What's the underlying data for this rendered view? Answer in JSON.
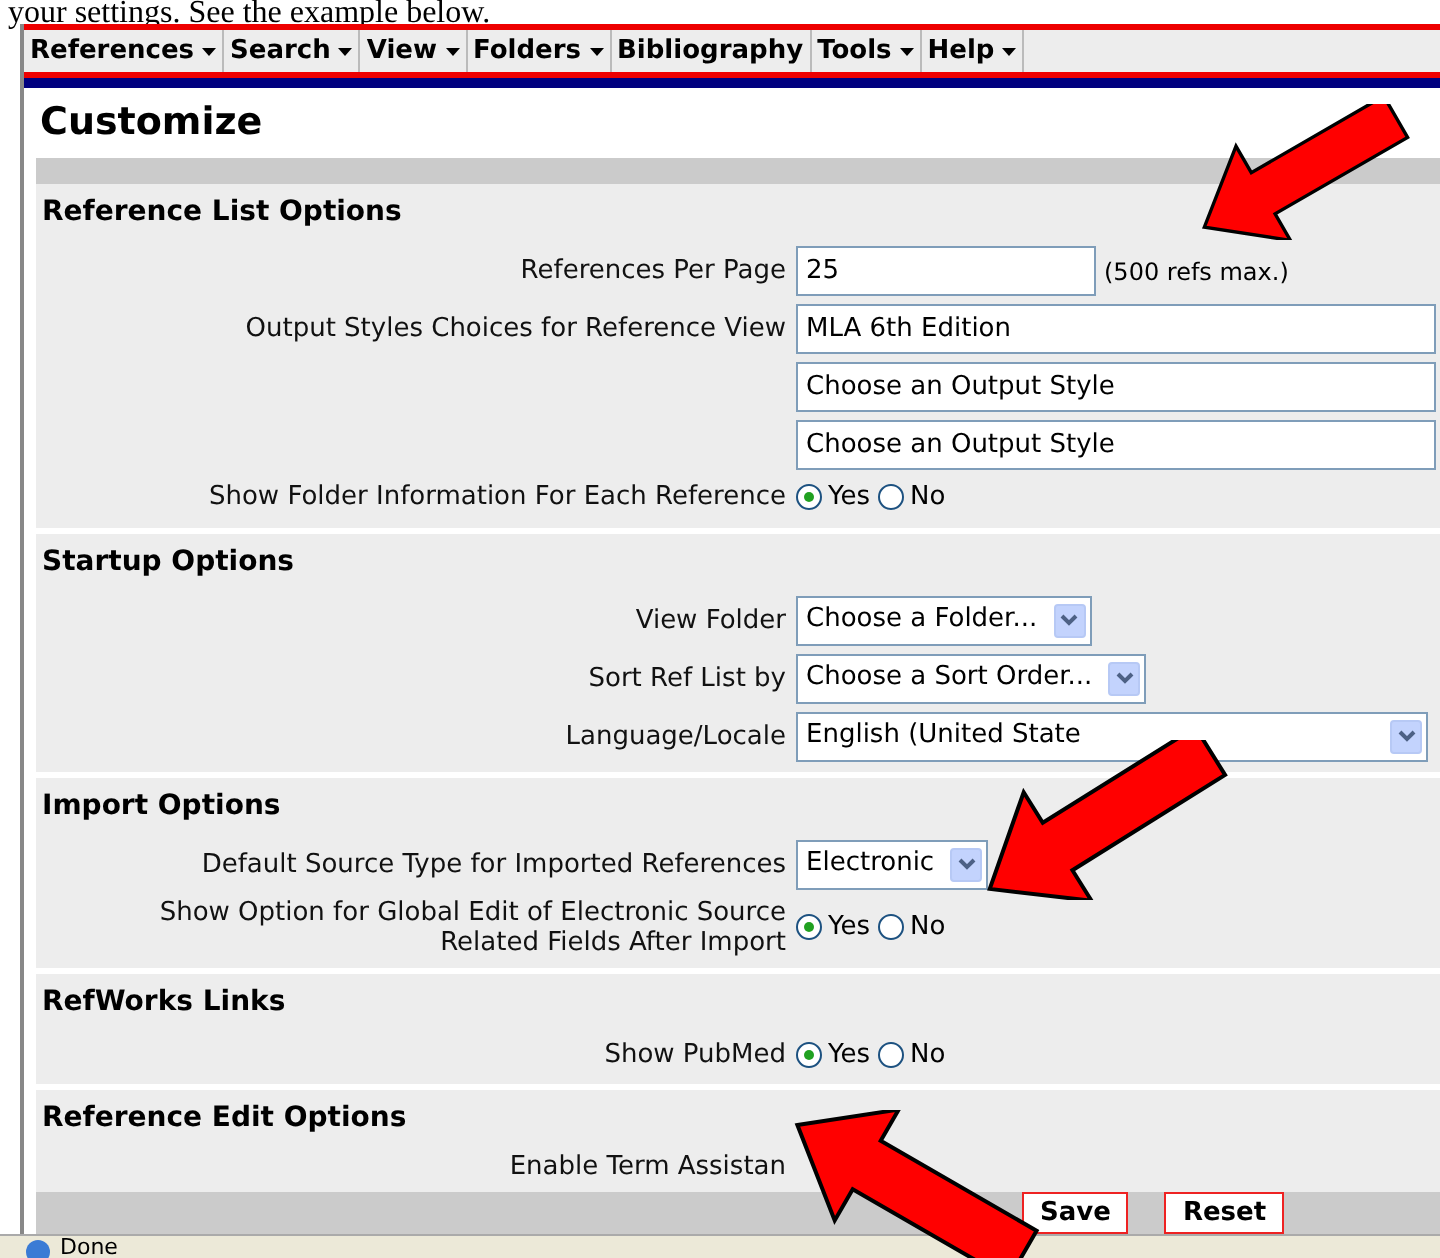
{
  "caption": "your settings.  See the example below.",
  "menu": [
    {
      "label": "References",
      "dropdown": true
    },
    {
      "label": "Search",
      "dropdown": true
    },
    {
      "label": "View",
      "dropdown": true
    },
    {
      "label": "Folders",
      "dropdown": true
    },
    {
      "label": "Bibliography",
      "dropdown": false
    },
    {
      "label": "Tools",
      "dropdown": true
    },
    {
      "label": "Help",
      "dropdown": true
    }
  ],
  "page_title": "Customize",
  "sections": [
    {
      "title": "Reference List Options",
      "rows": [
        {
          "kind": "text",
          "label": "References Per Page",
          "value": "25",
          "note": "(500 refs max.)"
        },
        {
          "kind": "wide",
          "label": "Output Styles Choices for Reference View",
          "value": "MLA 6th Edition"
        },
        {
          "kind": "wide",
          "value": "Choose an Output Style"
        },
        {
          "kind": "wide",
          "value": "Choose an Output Style"
        },
        {
          "kind": "radio",
          "label": "Show Folder Information For Each Reference",
          "options": [
            {
              "label": "Yes",
              "selected": true
            },
            {
              "label": "No",
              "selected": false
            }
          ]
        }
      ]
    },
    {
      "title": "Startup Options",
      "rows": [
        {
          "kind": "select",
          "label": "View Folder",
          "value": "Choose a Folder..."
        },
        {
          "kind": "select",
          "label": "Sort Ref List by",
          "value": "Choose a Sort Order..."
        },
        {
          "kind": "wideselect",
          "label": "Language/Locale",
          "value": "English (United State"
        }
      ]
    },
    {
      "title": "Import Options",
      "rows": [
        {
          "kind": "select",
          "label": "Default Source Type for Imported References",
          "value": "Electronic"
        },
        {
          "kind": "radio",
          "label": "Show Option for Global Edit of Electronic Source Related Fields After Import",
          "options": [
            {
              "label": "Yes",
              "selected": true
            },
            {
              "label": "No",
              "selected": false
            }
          ]
        }
      ]
    },
    {
      "title": "RefWorks Links",
      "rows": [
        {
          "kind": "radio",
          "label": "Show PubMed",
          "options": [
            {
              "label": "Yes",
              "selected": true
            },
            {
              "label": "No",
              "selected": false
            }
          ]
        }
      ]
    },
    {
      "title": "Reference Edit Options",
      "rows": [
        {
          "kind": "plain",
          "label": "Enable Term Assistan"
        }
      ]
    }
  ],
  "buttons": [
    "Save",
    "Reset"
  ],
  "status": "Done"
}
